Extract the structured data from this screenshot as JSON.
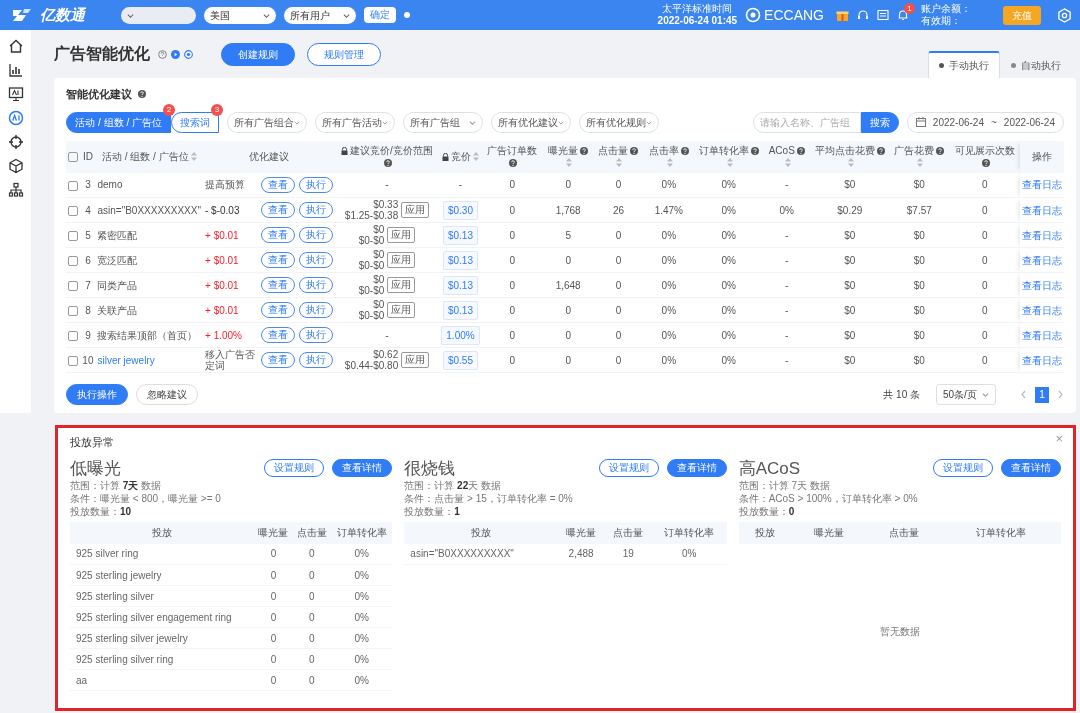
{
  "topbar": {
    "logo": "亿数通",
    "fields": [
      {
        "kind": "blank"
      },
      {
        "kind": "select",
        "value": "美国"
      },
      {
        "kind": "select",
        "value": "所有用户"
      }
    ],
    "confirm": "确定",
    "timezone": "太平洋标准时间",
    "time": "2022-06-24 01:45",
    "brand": "ECCANG",
    "notification_count": "1",
    "balance_label": "账户余额：",
    "expiry_label": "有效期：",
    "recharge": "充值"
  },
  "sidebar": [
    {
      "selected": false
    },
    {
      "selected": false
    },
    {
      "selected": false
    },
    {
      "selected": true
    },
    {
      "selected": false
    },
    {
      "selected": false
    },
    {
      "selected": false
    }
  ],
  "page": {
    "title": "广告智能优化",
    "buttons": [
      {
        "label": "创建规则",
        "kind": "primary"
      },
      {
        "label": "规则管理",
        "kind": "outline"
      }
    ],
    "mode_tabs": [
      {
        "label": "手动执行",
        "selected": true
      },
      {
        "label": "自动执行",
        "selected": false
      }
    ]
  },
  "suggestions": {
    "title": "智能优化建议",
    "level_tabs": [
      {
        "label": "活动 / 组数 / 广告位",
        "count": "2",
        "selected": true
      },
      {
        "label": "搜索词",
        "count": "3",
        "selected": false
      }
    ],
    "filters": [
      "所有广告组合",
      "所有广告活动",
      "所有广告组",
      "所有优化建议",
      "所有优化规则"
    ],
    "search": {
      "placeholder": "请输入名称、广告组",
      "button": "搜索"
    },
    "date_range": {
      "start": "2022-06-24",
      "separator": "~",
      "end": "2022-06-24"
    },
    "table": {
      "all_checked": false,
      "columns": [
        {
          "label": "ID"
        },
        {
          "label": "活动 / 组数 / 广告位",
          "sortable": true
        },
        {
          "label": "优化建议",
          "kind": "suggestion"
        },
        {
          "label": "建议竞价/竞价范围",
          "locked": true,
          "info": true
        },
        {
          "label": "竞价",
          "locked": true,
          "sortable": true
        },
        {
          "label": "广告订单数",
          "info": true
        },
        {
          "label": "曝光量",
          "info": true,
          "sortable": true
        },
        {
          "label": "点击量",
          "info": true,
          "sortable": true
        },
        {
          "label": "点击率",
          "info": true,
          "sortable": true
        },
        {
          "label": "订单转化率",
          "info": true,
          "sortable": true
        },
        {
          "label": "ACoS",
          "info": true,
          "sortable": true
        },
        {
          "label": "平均点击花费",
          "info": true,
          "sortable": true
        },
        {
          "label": "广告花费",
          "info": true,
          "sortable": true
        },
        {
          "label": "可见展示次数",
          "info": true
        },
        {
          "label": "操作",
          "kind": "action"
        }
      ],
      "rows": [
        {
          "checked": false,
          "id": "3",
          "name": "demo",
          "link": false,
          "suggestion": {
            "text": "提高预算",
            "kind": "plain"
          },
          "actions": [
            "查看",
            "执行"
          ],
          "bid_suggestion": {
            "value": "-"
          },
          "bid": {
            "value": "-",
            "boxed": false
          },
          "metrics": [
            "0",
            "0",
            "0",
            "0%",
            "0%",
            "-",
            "$0",
            "$0",
            "0"
          ],
          "operation": "查看日志"
        },
        {
          "checked": false,
          "id": "4",
          "name": "asin=\"B0XXXXXXXXX\"",
          "link": false,
          "suggestion": {
            "text": "- $-0.03",
            "kind": "down"
          },
          "actions": [
            "查看",
            "执行"
          ],
          "bid_suggestion": {
            "value": "$0.33",
            "range": "$1.25-$0.38",
            "apply": "应用"
          },
          "bid": {
            "value": "$0.30",
            "boxed": true
          },
          "metrics": [
            "0",
            "1,768",
            "26",
            "1.47%",
            "0%",
            "0%",
            "$0.29",
            "$7.57",
            "0"
          ],
          "operation": "查看日志"
        },
        {
          "checked": false,
          "id": "5",
          "name": "紧密匹配",
          "link": false,
          "suggestion": {
            "text": "+ $0.01",
            "kind": "up"
          },
          "actions": [
            "查看",
            "执行"
          ],
          "bid_suggestion": {
            "value": "$0",
            "range": "$0-$0",
            "apply": "应用"
          },
          "bid": {
            "value": "$0.13",
            "boxed": true
          },
          "metrics": [
            "0",
            "5",
            "0",
            "0%",
            "0%",
            "-",
            "$0",
            "$0",
            "0"
          ],
          "operation": "查看日志"
        },
        {
          "checked": false,
          "id": "6",
          "name": "宽泛匹配",
          "link": false,
          "suggestion": {
            "text": "+ $0.01",
            "kind": "up"
          },
          "actions": [
            "查看",
            "执行"
          ],
          "bid_suggestion": {
            "value": "$0",
            "range": "$0-$0",
            "apply": "应用"
          },
          "bid": {
            "value": "$0.13",
            "boxed": true
          },
          "metrics": [
            "0",
            "0",
            "0",
            "0%",
            "0%",
            "-",
            "$0",
            "$0",
            "0"
          ],
          "operation": "查看日志"
        },
        {
          "checked": false,
          "id": "7",
          "name": "同类产品",
          "link": false,
          "suggestion": {
            "text": "+ $0.01",
            "kind": "up"
          },
          "actions": [
            "查看",
            "执行"
          ],
          "bid_suggestion": {
            "value": "$0",
            "range": "$0-$0",
            "apply": "应用"
          },
          "bid": {
            "value": "$0.13",
            "boxed": true
          },
          "metrics": [
            "0",
            "1,648",
            "0",
            "0%",
            "0%",
            "-",
            "$0",
            "$0",
            "0"
          ],
          "operation": "查看日志"
        },
        {
          "checked": false,
          "id": "8",
          "name": "关联产品",
          "link": false,
          "suggestion": {
            "text": "+ $0.01",
            "kind": "up"
          },
          "actions": [
            "查看",
            "执行"
          ],
          "bid_suggestion": {
            "value": "$0",
            "range": "$0-$0",
            "apply": "应用"
          },
          "bid": {
            "value": "$0.13",
            "boxed": true
          },
          "metrics": [
            "0",
            "0",
            "0",
            "0%",
            "0%",
            "-",
            "$0",
            "$0",
            "0"
          ],
          "operation": "查看日志"
        },
        {
          "checked": false,
          "id": "9",
          "name": "搜索结果顶部（首页）",
          "link": false,
          "suggestion": {
            "text": "+ 1.00%",
            "kind": "up"
          },
          "actions": [
            "查看",
            "执行"
          ],
          "bid_suggestion": {
            "value": "-"
          },
          "bid": {
            "value": "1.00%",
            "boxed": true
          },
          "metrics": [
            "0",
            "0",
            "0",
            "0%",
            "0%",
            "-",
            "$0",
            "$0",
            "0"
          ],
          "operation": "查看日志"
        },
        {
          "checked": false,
          "id": "10",
          "name": "silver jewelry",
          "link": true,
          "suggestion": {
            "text": "移入广告否定词",
            "kind": "plain"
          },
          "actions": [
            "查看",
            "执行"
          ],
          "bid_suggestion": {
            "value": "$0.62",
            "range": "$0.44-$0.80",
            "apply": "应用"
          },
          "bid": {
            "value": "$0.55",
            "boxed": true
          },
          "metrics": [
            "0",
            "0",
            "0",
            "0%",
            "0%",
            "-",
            "$0",
            "$0",
            "0"
          ],
          "operation": "查看日志"
        }
      ]
    },
    "footer_buttons": [
      {
        "label": "执行操作",
        "kind": "primary"
      },
      {
        "label": "忽略建议",
        "kind": "plain"
      }
    ],
    "pagination": {
      "total": "共 10 条",
      "page_size": "50条/页",
      "pages": [
        {
          "label": "1",
          "selected": true
        }
      ]
    }
  },
  "anomalies": {
    "title": "投放异常",
    "close": "×",
    "groups": [
      {
        "title": "低曝光",
        "buttons": [
          {
            "label": "设置规则",
            "kind": "outline"
          },
          {
            "label": "查看详情",
            "kind": "primary"
          }
        ],
        "lines": [
          "范围：计算 **7天** 数据",
          "条件：曝光量 < 800，曝光量 >= 0",
          "投放数量：**10**"
        ],
        "columns": [
          "投放",
          "曝光量",
          "点击量",
          "订单转化率"
        ],
        "rows": [
          [
            "925 silver ring",
            "0",
            "0",
            "0%"
          ],
          [
            "925 sterling jewelry",
            "0",
            "0",
            "0%"
          ],
          [
            "925 sterling silver",
            "0",
            "0",
            "0%"
          ],
          [
            "925 sterling silver engagement ring",
            "0",
            "0",
            "0%"
          ],
          [
            "925 sterling silver jewelry",
            "0",
            "0",
            "0%"
          ],
          [
            "925 sterling silver ring",
            "0",
            "0",
            "0%"
          ],
          [
            "aa",
            "0",
            "0",
            "0%"
          ]
        ]
      },
      {
        "title": "很烧钱",
        "buttons": [
          {
            "label": "设置规则",
            "kind": "outline"
          },
          {
            "label": "查看详情",
            "kind": "primary"
          }
        ],
        "lines": [
          "范围：计算 **22**天 数据",
          "条件：点击量 > 15，订单转化率 = 0%",
          "投放数量：**1**"
        ],
        "columns": [
          "投放",
          "曝光量",
          "点击量",
          "订单转化率"
        ],
        "rows": [
          [
            "asin=\"B0XXXXXXXXX\"",
            "2,488",
            "19",
            "0%"
          ]
        ]
      },
      {
        "title": "高ACoS",
        "buttons": [
          {
            "label": "设置规则",
            "kind": "outline"
          },
          {
            "label": "查看详情",
            "kind": "primary"
          }
        ],
        "lines": [
          "范围：计算 7天 数据",
          "条件：ACoS > 100%，订单转化率 > 0%",
          "投放数量：**0**"
        ],
        "columns": [
          "投放",
          "曝光量",
          "点击量",
          "订单转化率"
        ],
        "empty": "暂无数据"
      }
    ]
  }
}
